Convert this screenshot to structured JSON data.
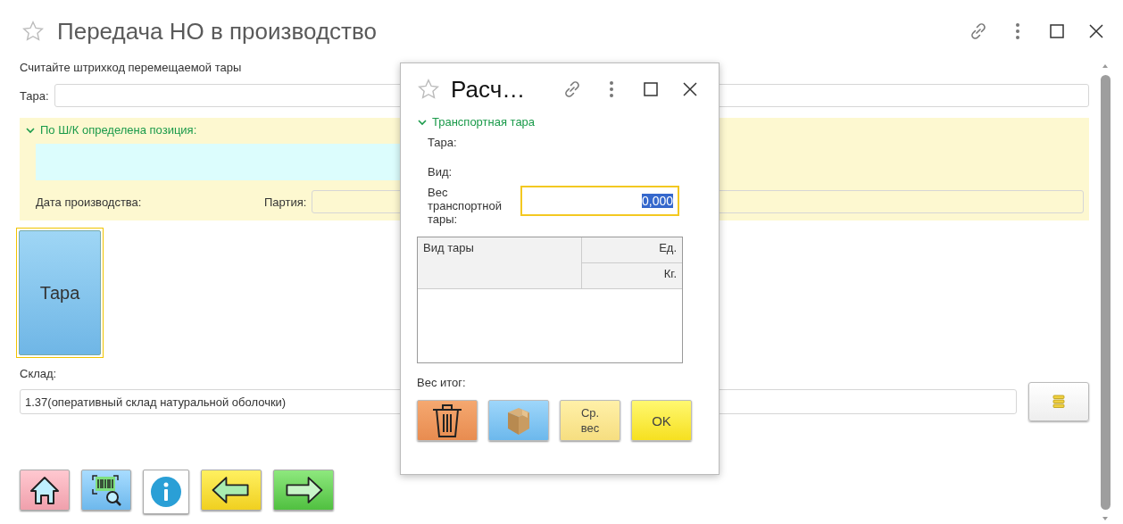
{
  "window": {
    "title": "Передача НО в производство"
  },
  "prompt": "Считайте штрихкод перемещаемой тары",
  "tara_field": {
    "label": "Тара:"
  },
  "position_group": {
    "title": "По Ш/К определена позиция:",
    "expanded": true,
    "date_label": "Дата производства:",
    "batch_label": "Партия:"
  },
  "tara_button": {
    "label": "Тара"
  },
  "warehouse": {
    "label": "Склад:",
    "value": "1.37(оперативный склад натуральной оболочки)"
  },
  "toolbar": [
    {
      "kind": "home"
    },
    {
      "kind": "barcode"
    },
    {
      "kind": "info"
    },
    {
      "kind": "back"
    },
    {
      "kind": "forward"
    }
  ],
  "dialog": {
    "title": "Расч…",
    "group": {
      "title": "Транспортная тара",
      "expanded": true
    },
    "fields": [
      {
        "label": "Тара:"
      },
      {
        "label": "Вид:"
      }
    ],
    "weight": {
      "label": "Вес транспортной тары:",
      "value": "0,000"
    },
    "table": {
      "columns": [
        "Вид тары",
        "Ед.",
        "Кг."
      ]
    },
    "total_label": "Вес итог:",
    "buttons": [
      {
        "kind": "delete"
      },
      {
        "kind": "box"
      },
      {
        "kind": "text",
        "label": "Ср. вес"
      },
      {
        "kind": "ok",
        "label": "OK"
      }
    ]
  }
}
